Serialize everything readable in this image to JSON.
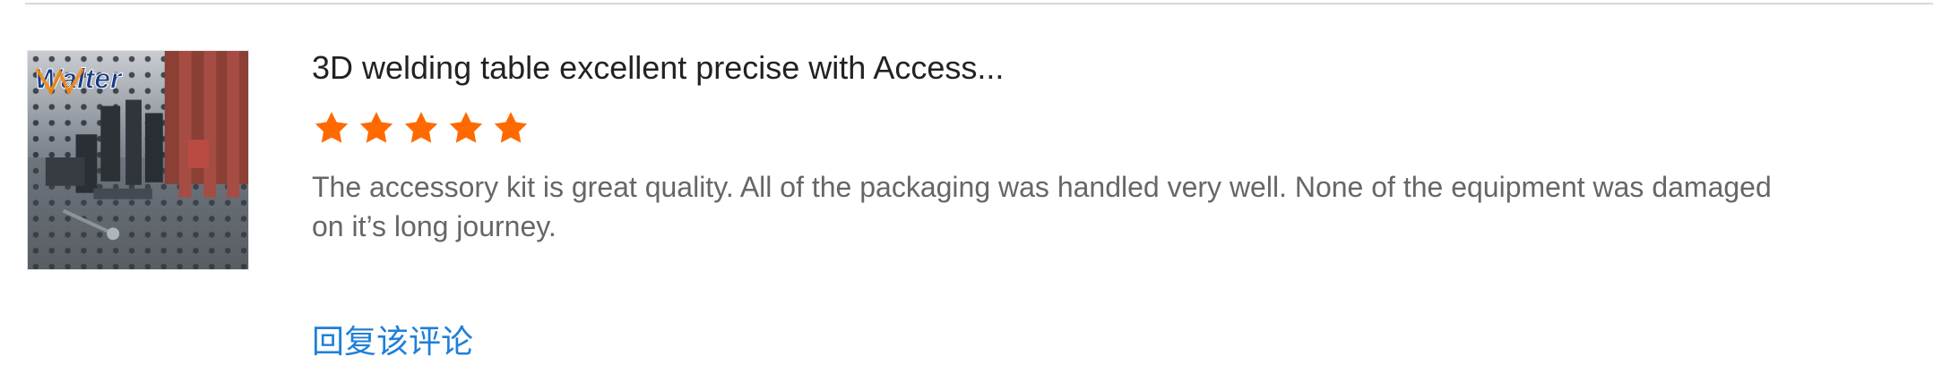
{
  "review": {
    "product_title": "3D welding table excellent precise with Access...",
    "rating": {
      "value": 5,
      "max": 5
    },
    "text": "The accessory kit is great quality. All of the packaging was handled very well. None of the equipment was damaged on it’s long journey.",
    "reply_label": "回复该评论",
    "thumbnail": {
      "brand_mark": "Walter"
    }
  },
  "colors": {
    "star": "#ff6a00",
    "title": "#222222",
    "text": "#666666",
    "link": "#1f7fd8",
    "divider": "#d9d9d9"
  }
}
